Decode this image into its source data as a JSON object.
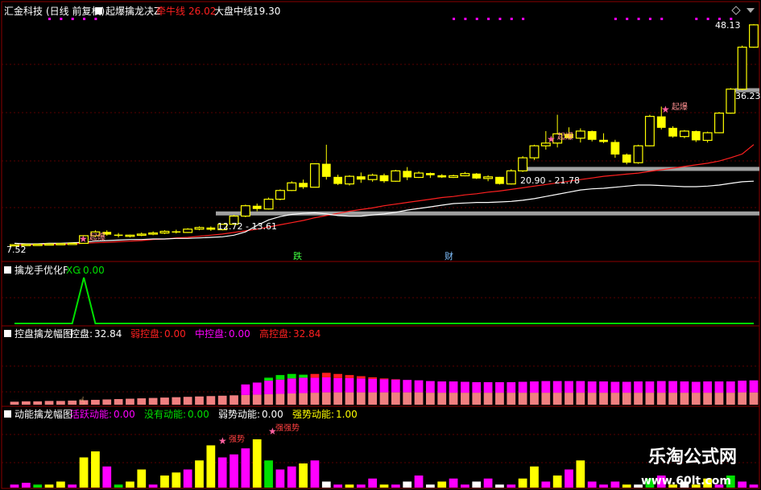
{
  "colors": {
    "bg": "#000000",
    "grid_red": "#8b0000",
    "yellow": "#ffff00",
    "red": "#ff2020",
    "white": "#ffffff",
    "green": "#00e000",
    "magenta": "#ff00ff",
    "salmon": "#f08080",
    "gray_band": "#a0a0a0",
    "watermark": "#ffffff"
  },
  "panels": {
    "main": {
      "stock_name": "汇金科技",
      "period": "(日线 前复权)",
      "indicator": "起爆擒龙决Z",
      "legend": [
        {
          "label": "牵牛线",
          "value": "26.02",
          "color": "#ff2020"
        },
        {
          "label": "大盘中线",
          "value": "19.30",
          "color": "#ffffff"
        }
      ],
      "price_labels": {
        "high": "48.13",
        "mid": "36.23",
        "low": "7.52"
      },
      "range_labels": [
        "12.72 - 13.61",
        "20.90 - 21.78"
      ],
      "markers": [
        "起爆",
        "起爆",
        "起爆",
        "起爆"
      ],
      "event_labels": [
        "跌",
        "财"
      ]
    },
    "p2": {
      "title": "擒龙手优化F",
      "series": [
        {
          "label": "XG",
          "value": "0.00",
          "color": "#00e000"
        }
      ]
    },
    "p3": {
      "title": "控盘擒龙幅图",
      "series": [
        {
          "label": "控盘",
          "value": "32.84",
          "color": "#ffffff"
        },
        {
          "label": "弱控盘",
          "value": "0.00",
          "color": "#ff2020"
        },
        {
          "label": "中控盘",
          "value": "0.00",
          "color": "#ff00ff"
        },
        {
          "label": "高控盘",
          "value": "32.84",
          "color": "#ff2020"
        }
      ]
    },
    "p4": {
      "title": "动能擒龙幅图",
      "series": [
        {
          "label": "活跃动能",
          "value": "0.00",
          "color": "#ff00ff"
        },
        {
          "label": "没有动能",
          "value": "0.00",
          "color": "#00e000"
        },
        {
          "label": "弱势动能",
          "value": "0.00",
          "color": "#ffffff"
        },
        {
          "label": "强势动能",
          "value": "1.00",
          "color": "#ffff00"
        }
      ],
      "markers": [
        "强势",
        "强强势"
      ]
    }
  },
  "watermark": {
    "title": "乐淘公式网",
    "url": "www.60lt.com"
  },
  "chart_data": [
    {
      "type": "candlestick",
      "title": "汇金科技 (日线 前复权)",
      "ylim": [
        7.52,
        48.13
      ],
      "candles": [
        [
          7.6,
          7.7,
          7.5,
          7.65
        ],
        [
          7.6,
          7.75,
          7.55,
          7.7
        ],
        [
          7.7,
          7.8,
          7.6,
          7.72
        ],
        [
          7.72,
          7.9,
          7.6,
          7.8
        ],
        [
          7.8,
          7.9,
          7.7,
          7.85
        ],
        [
          7.85,
          8.0,
          7.8,
          7.9
        ],
        [
          7.9,
          9.4,
          7.9,
          9.3
        ],
        [
          9.3,
          10.3,
          9.0,
          10.0
        ],
        [
          10.0,
          10.3,
          9.3,
          9.5
        ],
        [
          9.5,
          9.8,
          9.0,
          9.3
        ],
        [
          9.3,
          9.5,
          9.0,
          9.4
        ],
        [
          9.4,
          9.9,
          9.2,
          9.6
        ],
        [
          9.6,
          10.1,
          9.4,
          9.8
        ],
        [
          9.8,
          10.3,
          9.6,
          10.1
        ],
        [
          10.1,
          10.4,
          9.7,
          9.9
        ],
        [
          9.9,
          10.7,
          9.8,
          10.5
        ],
        [
          10.5,
          11.0,
          10.3,
          10.8
        ],
        [
          10.8,
          11.0,
          10.2,
          10.4
        ],
        [
          10.4,
          11.5,
          10.3,
          11.4
        ],
        [
          11.4,
          13.1,
          11.3,
          12.9
        ],
        [
          12.9,
          15.0,
          12.7,
          14.8
        ],
        [
          14.8,
          15.2,
          13.8,
          14.2
        ],
        [
          14.2,
          16.3,
          14.1,
          16.0
        ],
        [
          16.0,
          17.8,
          15.8,
          17.6
        ],
        [
          17.6,
          19.3,
          17.5,
          19.0
        ],
        [
          19.0,
          19.6,
          17.9,
          18.2
        ],
        [
          18.2,
          22.6,
          18.2,
          22.5
        ],
        [
          22.5,
          26.0,
          19.6,
          20.1
        ],
        [
          20.1,
          20.5,
          18.6,
          18.8
        ],
        [
          18.8,
          20.4,
          18.5,
          20.2
        ],
        [
          20.2,
          20.9,
          19.0,
          19.6
        ],
        [
          19.6,
          20.7,
          19.2,
          20.4
        ],
        [
          20.4,
          20.7,
          19.0,
          19.3
        ],
        [
          19.3,
          21.4,
          19.2,
          21.2
        ],
        [
          21.2,
          21.9,
          19.5,
          20.0
        ],
        [
          20.0,
          21.1,
          19.9,
          20.8
        ],
        [
          20.8,
          20.9,
          19.9,
          20.4
        ],
        [
          20.4,
          20.6,
          19.9,
          20.0
        ],
        [
          20.0,
          20.5,
          19.9,
          20.3
        ],
        [
          20.3,
          21.0,
          20.2,
          20.7
        ],
        [
          20.7,
          20.8,
          19.7,
          19.8
        ],
        [
          19.8,
          20.4,
          19.3,
          20.1
        ],
        [
          20.1,
          20.1,
          18.7,
          18.8
        ],
        [
          18.8,
          21.5,
          18.7,
          21.2
        ],
        [
          21.2,
          23.9,
          21.0,
          23.6
        ],
        [
          23.6,
          26.0,
          23.2,
          25.8
        ],
        [
          25.8,
          28.5,
          25.1,
          26.3
        ],
        [
          26.3,
          31.5,
          25.5,
          28.0
        ],
        [
          28.0,
          29.2,
          27.0,
          27.2
        ],
        [
          27.2,
          29.0,
          26.4,
          28.5
        ],
        [
          28.5,
          28.6,
          26.6,
          26.9
        ],
        [
          26.9,
          28.1,
          26.3,
          26.5
        ],
        [
          26.5,
          26.9,
          23.6,
          24.2
        ],
        [
          24.2,
          24.4,
          22.4,
          22.7
        ],
        [
          22.7,
          26.0,
          22.5,
          25.8
        ],
        [
          25.8,
          31.5,
          25.7,
          31.2
        ],
        [
          31.2,
          33.0,
          28.8,
          29.1
        ],
        [
          29.1,
          29.4,
          27.3,
          27.5
        ],
        [
          27.5,
          28.7,
          27.2,
          28.5
        ],
        [
          28.5,
          28.6,
          26.5,
          26.8
        ],
        [
          26.8,
          28.4,
          26.4,
          28.2
        ],
        [
          28.2,
          32.0,
          28.1,
          31.8
        ],
        [
          31.8,
          36.4,
          31.7,
          36.2
        ],
        [
          36.2,
          44.2,
          36.0,
          43.9
        ],
        [
          43.9,
          48.13,
          43.8,
          48.0
        ]
      ],
      "lines": [
        {
          "name": "牵牛线",
          "color": "#ff2020",
          "values": [
            7.6,
            7.6,
            7.7,
            7.7,
            7.7,
            7.8,
            7.9,
            8.0,
            8.1,
            8.2,
            8.3,
            8.4,
            8.6,
            8.7,
            8.9,
            9.0,
            9.2,
            9.4,
            9.6,
            9.9,
            10.2,
            10.5,
            10.9,
            11.3,
            11.7,
            12.1,
            12.6,
            13.0,
            13.4,
            13.8,
            14.1,
            14.4,
            14.8,
            15.1,
            15.4,
            15.7,
            16.0,
            16.3,
            16.5,
            16.8,
            17.0,
            17.3,
            17.5,
            17.8,
            18.1,
            18.4,
            18.7,
            19.0,
            19.3,
            19.6,
            19.9,
            20.2,
            20.4,
            20.6,
            20.8,
            21.1,
            21.4,
            21.7,
            22.0,
            22.3,
            22.6,
            23.0,
            23.6,
            24.3,
            26.02
          ]
        },
        {
          "name": "大盘中线",
          "color": "#ffffff",
          "values": [
            7.9,
            7.8,
            7.8,
            7.9,
            7.9,
            8.0,
            8.1,
            8.3,
            8.4,
            8.5,
            8.6,
            8.6,
            8.7,
            8.7,
            8.8,
            8.8,
            8.9,
            9.0,
            9.1,
            9.4,
            10.0,
            11.2,
            12.2,
            12.8,
            13.2,
            13.4,
            13.5,
            13.3,
            13.0,
            12.9,
            12.9,
            13.1,
            13.3,
            13.6,
            14.0,
            14.3,
            14.6,
            14.9,
            15.2,
            15.3,
            15.4,
            15.4,
            15.5,
            15.6,
            15.8,
            16.1,
            16.5,
            16.9,
            17.3,
            17.7,
            17.9,
            18.0,
            18.2,
            18.4,
            18.6,
            18.6,
            18.5,
            18.4,
            18.3,
            18.3,
            18.4,
            18.6,
            18.9,
            19.2,
            19.3
          ]
        }
      ],
      "range_bands": [
        {
          "label": "12.72 - 13.61",
          "low": 12.72,
          "high": 13.61
        },
        {
          "label": "20.90 - 21.78",
          "low": 20.9,
          "high": 21.78
        },
        {
          "label": "36.23",
          "low": 36.23,
          "high": 36.23
        }
      ]
    },
    {
      "type": "line",
      "title": "擒龙手优化F",
      "series": [
        {
          "name": "XG",
          "values": [
            0,
            0,
            0,
            0,
            0,
            0,
            1,
            0,
            0,
            0,
            0,
            0,
            0,
            0,
            0,
            0,
            0,
            0,
            0,
            0,
            0,
            0,
            0,
            0,
            0,
            0,
            0,
            0,
            0,
            0,
            0,
            0,
            0,
            0,
            0,
            0,
            0,
            0,
            0,
            0,
            0,
            0,
            0,
            0,
            0,
            0,
            0,
            0,
            0,
            0,
            0,
            0,
            0,
            0,
            0,
            0,
            0,
            0,
            0,
            0,
            0,
            0,
            0,
            0,
            0
          ]
        }
      ]
    },
    {
      "type": "bar",
      "title": "控盘擒龙幅图",
      "series": [
        {
          "name": "控盘",
          "values": [
            8,
            9,
            9,
            10,
            10,
            11,
            12,
            13,
            14,
            15,
            16,
            17,
            18,
            19,
            20,
            21,
            22,
            23,
            24,
            25,
            26,
            27,
            28,
            29,
            30,
            31,
            32,
            33,
            33,
            33,
            33,
            33,
            33,
            33,
            33,
            33,
            32,
            32,
            32,
            32,
            32,
            32,
            32,
            32,
            32,
            32,
            32,
            32,
            32,
            32,
            32,
            32,
            32,
            32,
            32,
            32,
            32,
            32,
            32,
            32,
            32,
            32,
            32,
            33,
            32.84
          ]
        },
        {
          "name": "中控盘",
          "values": [
            0,
            0,
            0,
            0,
            0,
            0,
            0,
            0,
            0,
            0,
            0,
            0,
            0,
            0,
            0,
            0,
            0,
            0,
            0,
            0,
            28,
            32,
            36,
            38,
            40,
            41,
            40,
            40,
            38,
            38,
            37,
            36,
            35,
            34,
            33,
            32,
            31,
            30,
            30,
            29,
            28,
            28,
            28,
            28,
            29,
            30,
            31,
            31,
            31,
            31,
            30,
            30,
            29,
            29,
            30,
            30,
            31,
            31,
            30,
            29,
            30,
            30,
            30,
            31,
            32
          ]
        },
        {
          "name": "高控盘",
          "values": [
            0,
            0,
            0,
            0,
            0,
            0,
            0,
            0,
            0,
            0,
            0,
            0,
            0,
            0,
            0,
            0,
            0,
            0,
            0,
            0,
            0,
            0,
            8,
            12,
            12,
            8,
            0,
            0,
            0,
            0,
            0,
            0,
            0,
            0,
            0,
            0,
            0,
            0,
            0,
            0,
            0,
            0,
            0,
            0,
            0,
            0,
            0,
            0,
            0,
            0,
            0,
            0,
            0,
            0,
            0,
            0,
            0,
            0,
            0,
            0,
            0,
            0,
            0,
            0,
            0
          ]
        },
        {
          "name": "弱控盘",
          "values": [
            0,
            0,
            0,
            0,
            0,
            0,
            0,
            0,
            0,
            0,
            0,
            0,
            0,
            0,
            0,
            0,
            0,
            0,
            0,
            0,
            0,
            0,
            0,
            0,
            0,
            0,
            10,
            12,
            11,
            8,
            6,
            4,
            2,
            1,
            0,
            0,
            0,
            0,
            0,
            0,
            0,
            0,
            0,
            0,
            0,
            0,
            0,
            0,
            0,
            0,
            0,
            0,
            0,
            0,
            0,
            0,
            0,
            0,
            0,
            0,
            0,
            0,
            0,
            0,
            0
          ]
        }
      ]
    },
    {
      "type": "bar",
      "title": "动能擒龙幅图",
      "series": [
        {
          "name": "动能",
          "values": [
            0.05,
            0.08,
            0.05,
            0.05,
            0.1,
            0.05,
            0.5,
            0.6,
            0.35,
            0.05,
            0.1,
            0.3,
            0.05,
            0.2,
            0.25,
            0.3,
            0.45,
            0.7,
            0.5,
            0.55,
            0.65,
            0.8,
            0.45,
            0.3,
            0.35,
            0.4,
            0.45,
            0.1,
            0.05,
            0.05,
            0.05,
            0.15,
            0.05,
            0.05,
            0.1,
            0.2,
            0.05,
            0.1,
            0.15,
            0.05,
            0.1,
            0.15,
            0.05,
            0.05,
            0.15,
            0.35,
            0.1,
            0.2,
            0.3,
            0.45,
            0.1,
            0.05,
            0.1,
            0.05,
            0.05,
            0.15,
            0.2,
            0.05,
            0.1,
            0.05,
            0.15,
            0.05,
            0.2,
            0.1,
            0.05
          ],
          "colors": [
            "#ff00ff",
            "#ff00ff",
            "#00e000",
            "#ffff00",
            "#ffff00",
            "#ff00ff",
            "#ffff00",
            "#ffff00",
            "#ff00ff",
            "#00e000",
            "#ffff00",
            "#ffff00",
            "#ff00ff",
            "#ffff00",
            "#ffff00",
            "#ff00ff",
            "#ffff00",
            "#ffff00",
            "#ff00ff",
            "#ff00ff",
            "#ff00ff",
            "#ffff00",
            "#00e000",
            "#ff00ff",
            "#ff00ff",
            "#ffff00",
            "#ff00ff",
            "#ffffff",
            "#ff00ff",
            "#ffff00",
            "#ff00ff",
            "#ff00ff",
            "#ffff00",
            "#ff00ff",
            "#ffffff",
            "#ff00ff",
            "#ffffff",
            "#ffff00",
            "#ff00ff",
            "#ff00ff",
            "#ffffff",
            "#ff00ff",
            "#ffffff",
            "#ff00ff",
            "#ffff00",
            "#ffff00",
            "#ff00ff",
            "#ffff00",
            "#ff00ff",
            "#ffff00",
            "#ff00ff",
            "#ff00ff",
            "#ff00ff",
            "#ffff00",
            "#ffffff",
            "#00e000",
            "#ff00ff",
            "#ffff00",
            "#ffffff",
            "#ffff00",
            "#ffff00",
            "#ff00ff",
            "#00e000",
            "#ff00ff",
            "#ff00ff"
          ]
        }
      ]
    }
  ]
}
